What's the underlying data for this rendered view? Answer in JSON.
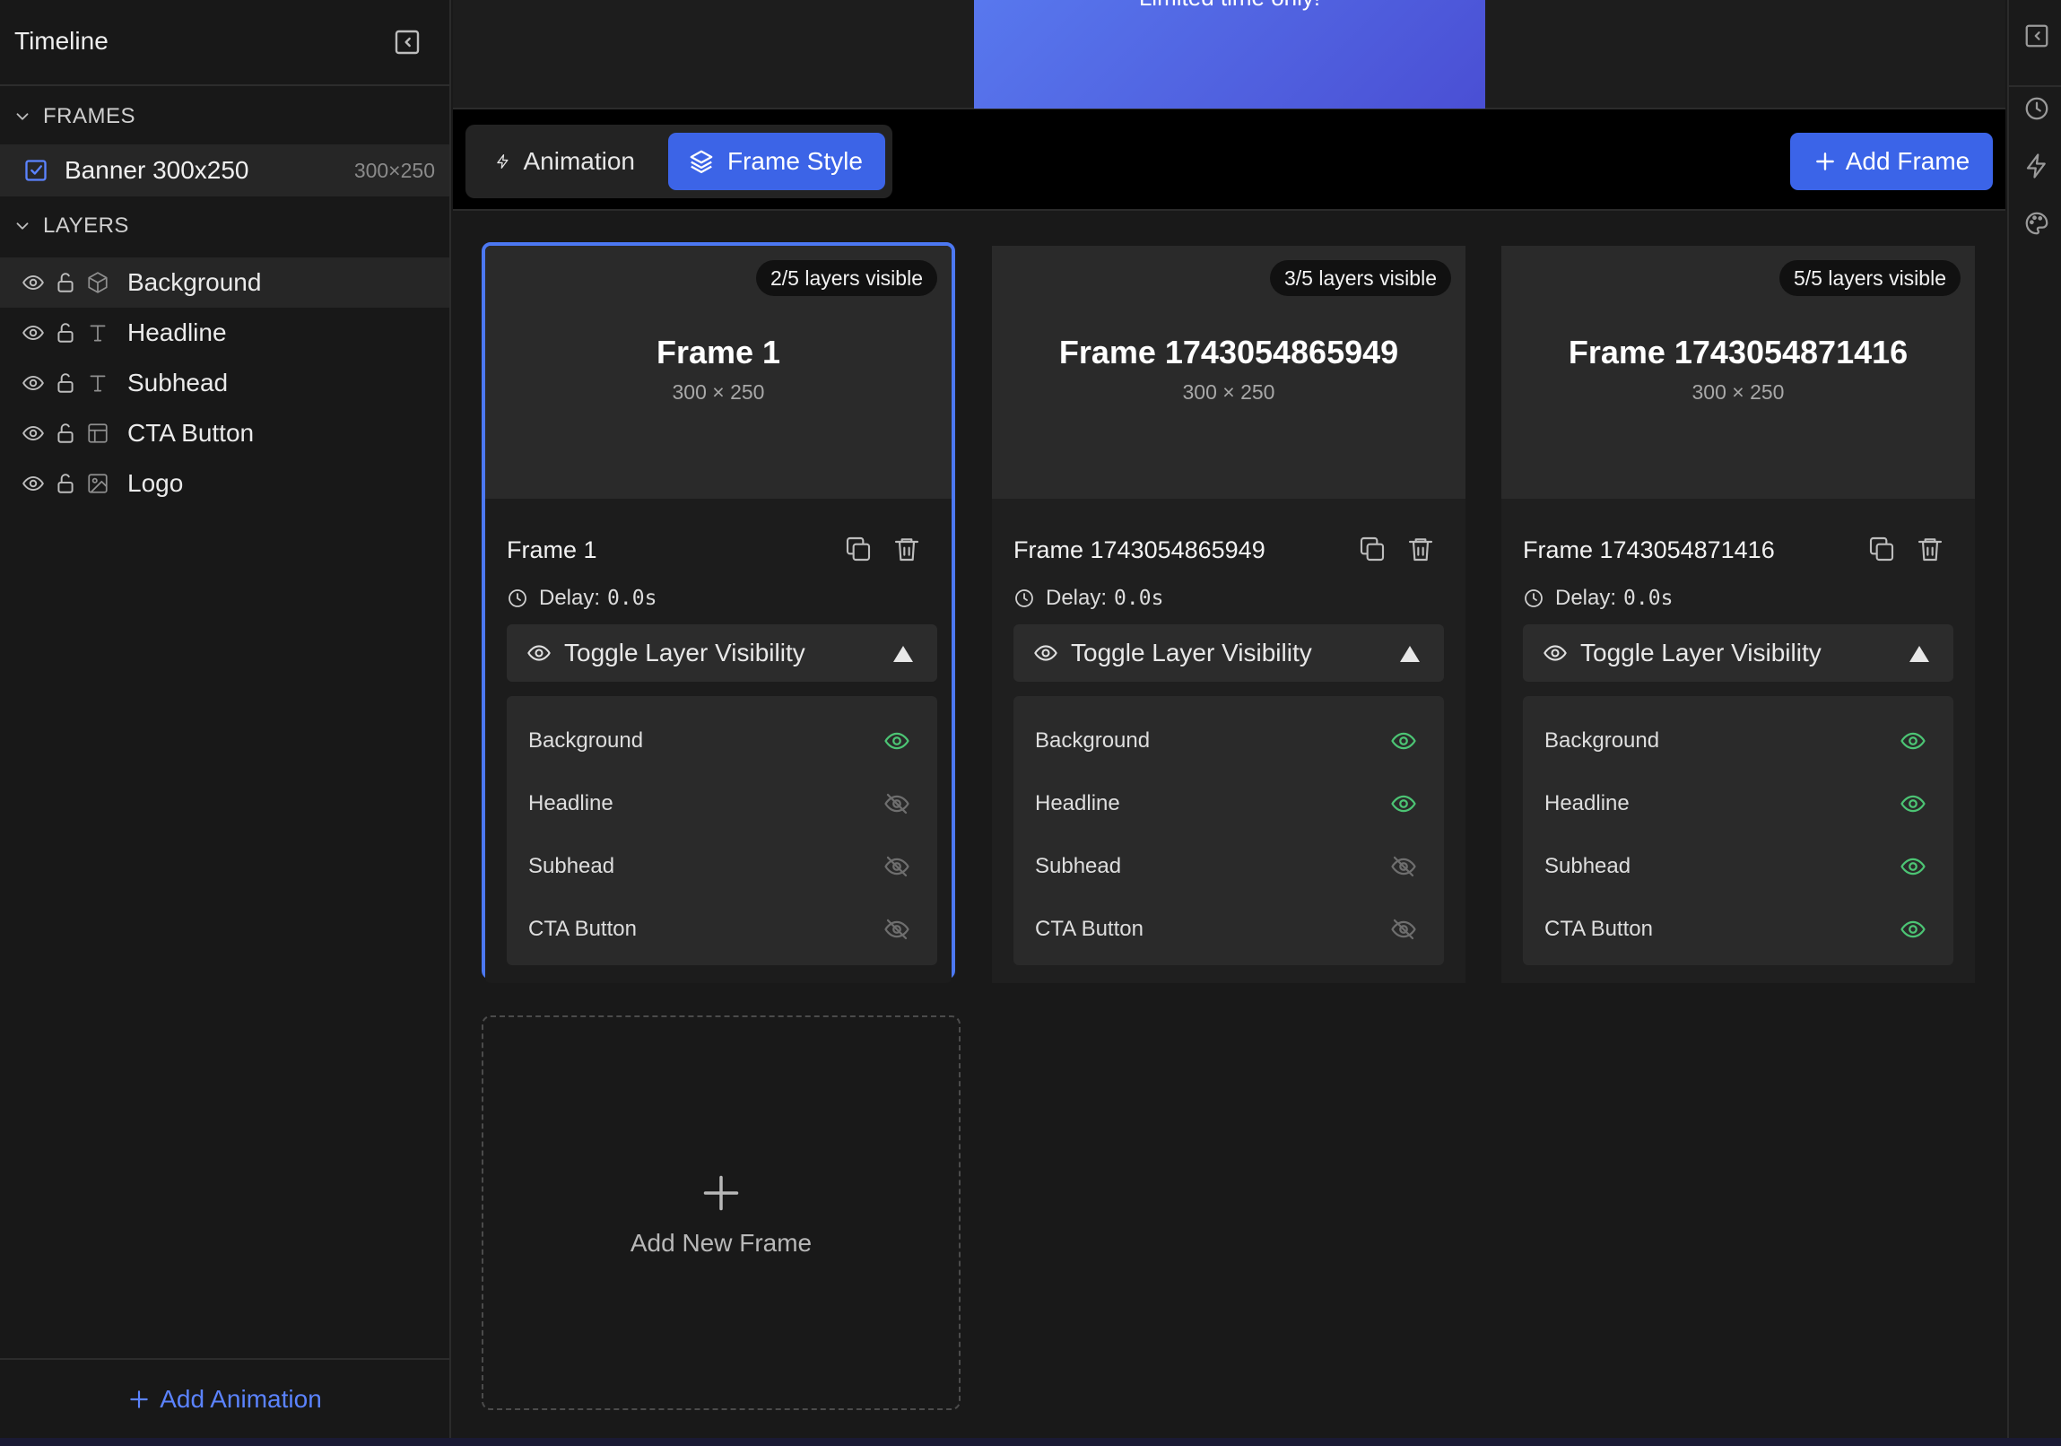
{
  "sidebar": {
    "title": "Timeline",
    "frames_section": "FRAMES",
    "frame_item": {
      "label": "Banner 300x250",
      "size": "300×250"
    },
    "layers_section": "LAYERS",
    "layers": [
      {
        "name": "Background",
        "type_icon": "cube-icon",
        "selected": true
      },
      {
        "name": "Headline",
        "type_icon": "text-icon"
      },
      {
        "name": "Subhead",
        "type_icon": "text-icon"
      },
      {
        "name": "CTA Button",
        "type_icon": "layout-icon"
      },
      {
        "name": "Logo",
        "type_icon": "image-icon"
      }
    ],
    "add_animation": "Add Animation"
  },
  "preview": {
    "banner_text": "Limited time only!"
  },
  "toolbar": {
    "tabs": [
      {
        "label": "Animation",
        "icon": "lightning-icon",
        "active": false
      },
      {
        "label": "Frame Style",
        "icon": "layers-icon",
        "active": true
      }
    ],
    "add_frame": "Add Frame"
  },
  "frames": [
    {
      "name": "Frame 1",
      "dimensions": "300 × 250",
      "badge": "2/5 layers visible",
      "delay_label": "Delay:",
      "delay_value": "0.0s",
      "toggle_label": "Toggle Layer Visibility",
      "selected": true,
      "layers": [
        {
          "name": "Background",
          "visible": true
        },
        {
          "name": "Headline",
          "visible": false
        },
        {
          "name": "Subhead",
          "visible": false
        },
        {
          "name": "CTA Button",
          "visible": false
        }
      ]
    },
    {
      "name": "Frame 1743054865949",
      "dimensions": "300 × 250",
      "badge": "3/5 layers visible",
      "delay_label": "Delay:",
      "delay_value": "0.0s",
      "toggle_label": "Toggle Layer Visibility",
      "selected": false,
      "layers": [
        {
          "name": "Background",
          "visible": true
        },
        {
          "name": "Headline",
          "visible": true
        },
        {
          "name": "Subhead",
          "visible": false
        },
        {
          "name": "CTA Button",
          "visible": false
        }
      ]
    },
    {
      "name": "Frame 1743054871416",
      "dimensions": "300 × 250",
      "badge": "5/5 layers visible",
      "delay_label": "Delay:",
      "delay_value": "0.0s",
      "toggle_label": "Toggle Layer Visibility",
      "selected": false,
      "layers": [
        {
          "name": "Background",
          "visible": true
        },
        {
          "name": "Headline",
          "visible": true
        },
        {
          "name": "Subhead",
          "visible": true
        },
        {
          "name": "CTA Button",
          "visible": true
        }
      ]
    }
  ],
  "add_new_frame": "Add New Frame",
  "colors": {
    "accent": "#3b64e8",
    "visible_eye": "#4cc474",
    "hidden_eye": "#6e6e6e",
    "panel": "#1f1f1f"
  }
}
